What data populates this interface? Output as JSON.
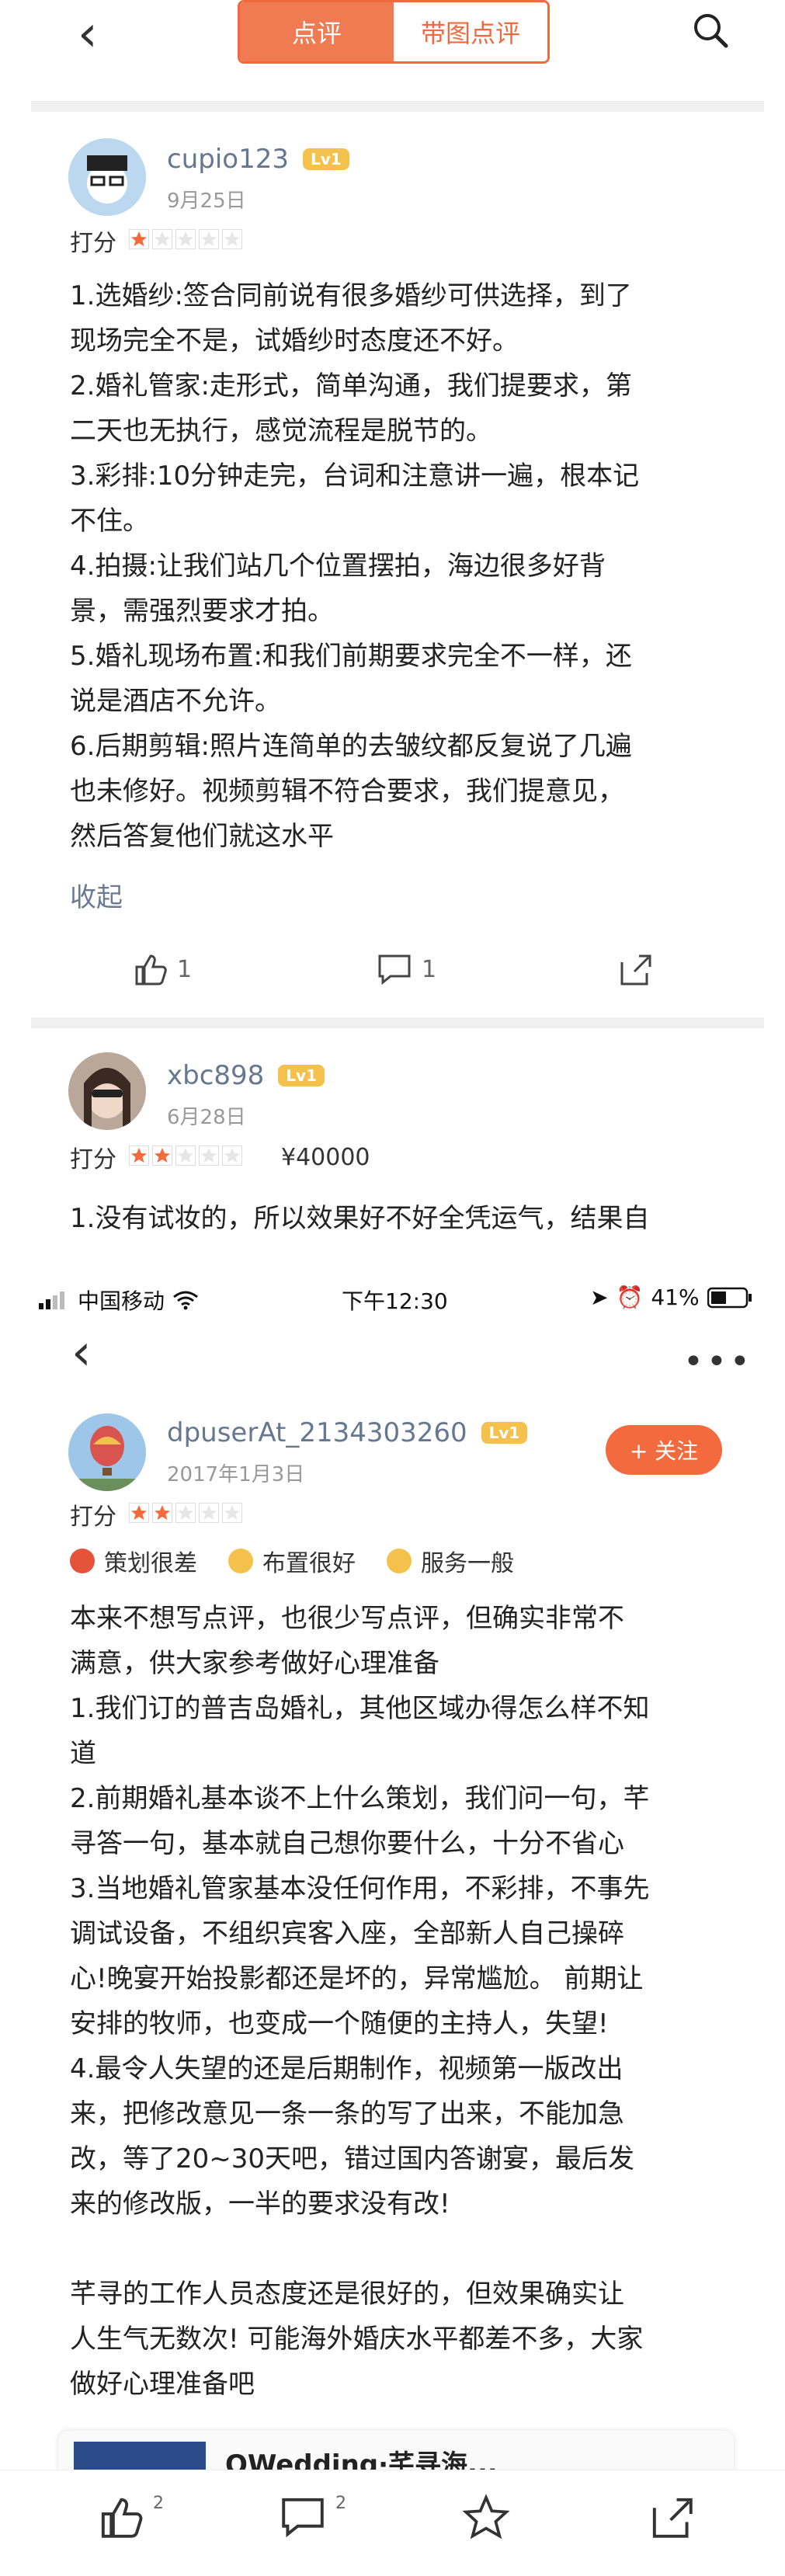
{
  "nav": {
    "tab_active": "点评",
    "tab_other": "带图点评"
  },
  "review1": {
    "username": "cupio123",
    "level": "Lv1",
    "date": "9月25日",
    "score_label": "打分",
    "rating": 1,
    "paragraphs": [
      "1.选婚纱:签合同前说有很多婚纱可供选择，到了",
      "现场完全不是，试婚纱时态度还不好。",
      "2.婚礼管家:走形式，简单沟通，我们提要求，第",
      "二天也无执行，感觉流程是脱节的。",
      "3.彩排:10分钟走完，台词和注意讲一遍，根本记",
      "不住。",
      "4.拍摄:让我们站几个位置摆拍，海边很多好背",
      "景，需强烈要求才拍。",
      "5.婚礼现场布置:和我们前期要求完全不一样，还",
      "说是酒店不允许。",
      "6.后期剪辑:照片连简单的去皱纹都反复说了几遍",
      "也未修好。视频剪辑不符合要求，我们提意见，",
      "然后答复他们就这水平"
    ],
    "collapse": "收起",
    "likes": "1",
    "comments": "1"
  },
  "review2": {
    "username": "xbc898",
    "level": "Lv1",
    "date": "6月28日",
    "score_label": "打分",
    "rating": 2,
    "price": "¥40000",
    "first_line": "1.没有试妆的，所以效果好不好全凭运气，结果自"
  },
  "status_bar": {
    "carrier": "中国移动",
    "time": "下午12:30",
    "battery": "41%"
  },
  "review3": {
    "username": "dpuserAt_2134303260",
    "level": "Lv1",
    "date": "2017年1月3日",
    "follow": "+ 关注",
    "score_label": "打分",
    "rating": 2,
    "tags": [
      "策划很差",
      "布置很好",
      "服务一般"
    ],
    "tag_colors": [
      "#e5533a",
      "#f4c14d",
      "#f4c14d"
    ],
    "paragraphs": [
      "本来不想写点评，也很少写点评，但确实非常不",
      "满意，供大家参考做好心理准备",
      "1.我们订的普吉岛婚礼，其他区域办得怎么样不知",
      "道",
      "2.前期婚礼基本谈不上什么策划，我们问一句，芊",
      "寻答一句，基本就自己想你要什么，十分不省心",
      "3.当地婚礼管家基本没任何作用，不彩排，不事先",
      "调试设备，不组织宾客入座，全部新人自己操碎",
      "心!晚宴开始投影都还是坏的，异常尴尬。 前期让",
      "安排的牧师，也变成一个随便的主持人，失望!",
      "4.最令人失望的还是后期制作，视频第一版改出",
      "来，把修改意见一条一条的写了出来，不能加急",
      "改，等了20~30天吧，错过国内答谢宴，最后发",
      "来的修改版，一半的要求没有改!",
      "",
      "芊寻的工作人员态度还是很好的，但效果确实让",
      "人生气无数次! 可能海外婚庆水平都差不多，大家",
      "做好心理准备吧"
    ],
    "shop_name": "QWedding·芊寻海..."
  },
  "bottom": {
    "likes": "2",
    "comments": "2"
  }
}
